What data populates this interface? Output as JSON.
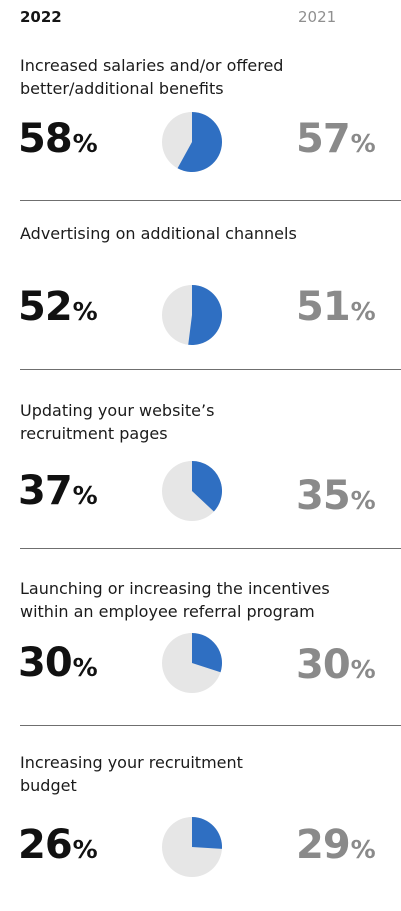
{
  "header": {
    "current_year": "2022",
    "previous_year": "2021"
  },
  "colors": {
    "pie_fill": "#2f6fc2",
    "pie_background": "#e6e6e6",
    "previous_year_text": "#8a8a8a"
  },
  "items": [
    {
      "title": "Increased salaries and/or offered\nbetter/additional benefits",
      "value_2022": "58",
      "value_2021": "57",
      "percent_sign": "%"
    },
    {
      "title": "Advertising on additional channels",
      "value_2022": "52",
      "value_2021": "51",
      "percent_sign": "%"
    },
    {
      "title": "Updating your website’s\nrecruitment pages",
      "value_2022": "37",
      "value_2021": "35",
      "percent_sign": "%"
    },
    {
      "title": "Launching or increasing the incentives\nwithin an employee referral program",
      "value_2022": "30",
      "value_2021": "30",
      "percent_sign": "%"
    },
    {
      "title": "Increasing your recruitment\nbudget",
      "value_2022": "26",
      "value_2021": "29",
      "percent_sign": "%"
    }
  ],
  "chart_data": {
    "type": "pie",
    "categories": [
      "Increased salaries and/or offered better/additional benefits",
      "Advertising on additional channels",
      "Updating your website’s recruitment pages",
      "Launching or increasing the incentives within an employee referral program",
      "Increasing your recruitment budget"
    ],
    "series": [
      {
        "name": "2022",
        "values": [
          58,
          52,
          37,
          30,
          26
        ]
      },
      {
        "name": "2021",
        "values": [
          57,
          51,
          35,
          30,
          29
        ]
      }
    ],
    "title": "",
    "xlabel": "",
    "ylabel": "",
    "ylim": [
      0,
      100
    ],
    "grid": false,
    "legend": "top"
  }
}
